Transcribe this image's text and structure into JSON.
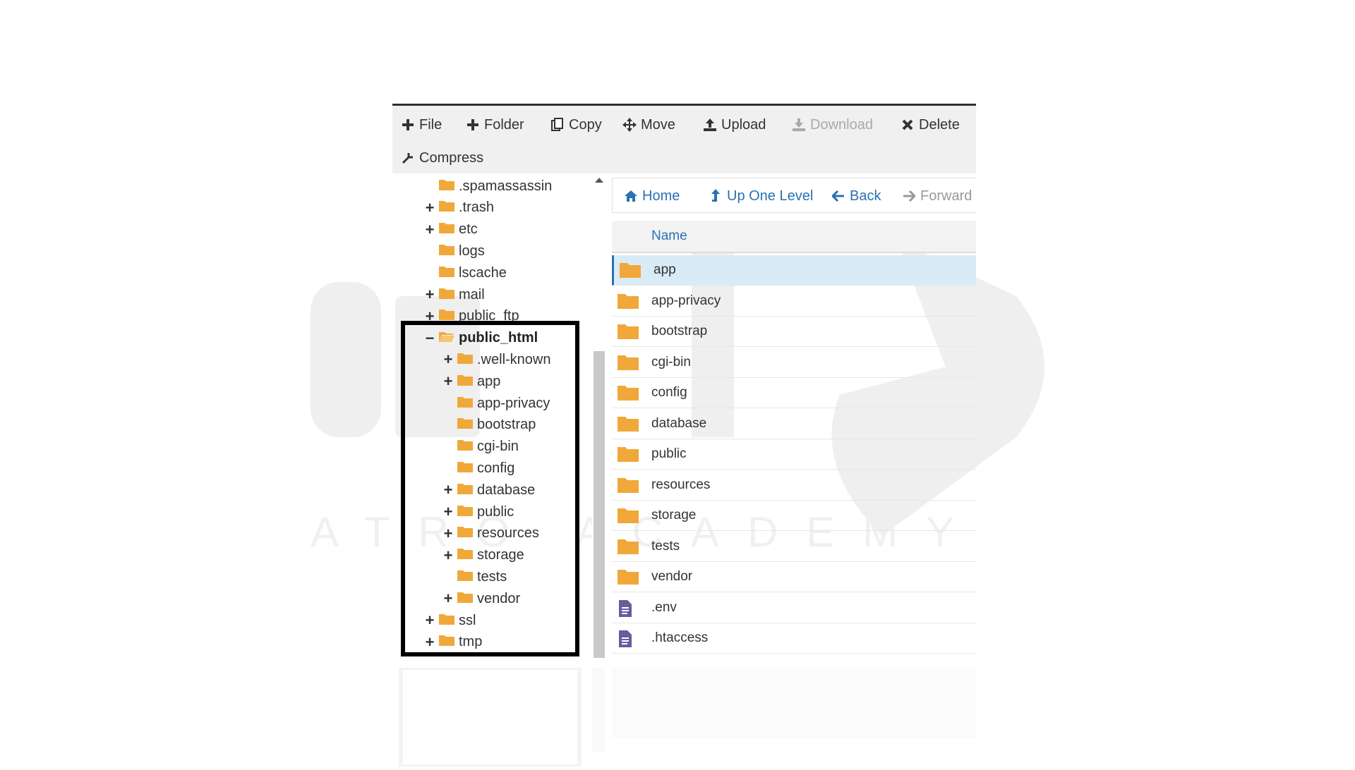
{
  "toolbar": {
    "file": "File",
    "folder": "Folder",
    "copy": "Copy",
    "move": "Move",
    "upload": "Upload",
    "download": "Download",
    "delete": "Delete",
    "compress": "Compress"
  },
  "tree": [
    {
      "label": ".spamassassin",
      "toggle": ""
    },
    {
      "label": ".trash",
      "toggle": "+"
    },
    {
      "label": "etc",
      "toggle": "+"
    },
    {
      "label": "logs",
      "toggle": ""
    },
    {
      "label": "lscache",
      "toggle": ""
    },
    {
      "label": "mail",
      "toggle": "+"
    },
    {
      "label": "public_ftp",
      "toggle": "+"
    },
    {
      "label": "public_html",
      "toggle": "−"
    },
    {
      "label": ".well-known",
      "toggle": "+"
    },
    {
      "label": "app",
      "toggle": "+"
    },
    {
      "label": "app-privacy",
      "toggle": ""
    },
    {
      "label": "bootstrap",
      "toggle": ""
    },
    {
      "label": "cgi-bin",
      "toggle": ""
    },
    {
      "label": "config",
      "toggle": ""
    },
    {
      "label": "database",
      "toggle": "+"
    },
    {
      "label": "public",
      "toggle": "+"
    },
    {
      "label": "resources",
      "toggle": "+"
    },
    {
      "label": "storage",
      "toggle": "+"
    },
    {
      "label": "tests",
      "toggle": ""
    },
    {
      "label": "vendor",
      "toggle": "+"
    },
    {
      "label": "ssl",
      "toggle": "+"
    },
    {
      "label": "tmp",
      "toggle": "+"
    }
  ],
  "nav": {
    "home": "Home",
    "up": "Up One Level",
    "back": "Back",
    "forward": "Forward"
  },
  "list": {
    "header": "Name",
    "items": [
      {
        "name": "app",
        "type": "folder"
      },
      {
        "name": "app-privacy",
        "type": "folder"
      },
      {
        "name": "bootstrap",
        "type": "folder"
      },
      {
        "name": "cgi-bin",
        "type": "folder"
      },
      {
        "name": "config",
        "type": "folder"
      },
      {
        "name": "database",
        "type": "folder"
      },
      {
        "name": "public",
        "type": "folder"
      },
      {
        "name": "resources",
        "type": "folder"
      },
      {
        "name": "storage",
        "type": "folder"
      },
      {
        "name": "tests",
        "type": "folder"
      },
      {
        "name": "vendor",
        "type": "folder"
      },
      {
        "name": ".env",
        "type": "file"
      },
      {
        "name": ".htaccess",
        "type": "file"
      }
    ]
  },
  "watermark": {
    "text": "ATRO ACADEMY"
  },
  "colors": {
    "accent": "#2a71b5",
    "folder": "#f0a83a",
    "file": "#6c5a9e",
    "selected_row": "#d9ebf7"
  },
  "icons": [
    "plus-icon",
    "copy-icon",
    "move-icon",
    "upload-icon",
    "download-icon",
    "delete-icon",
    "compress-icon",
    "home-icon",
    "up-icon",
    "back-arrow-icon",
    "forward-arrow-icon",
    "folder-icon",
    "file-icon"
  ]
}
